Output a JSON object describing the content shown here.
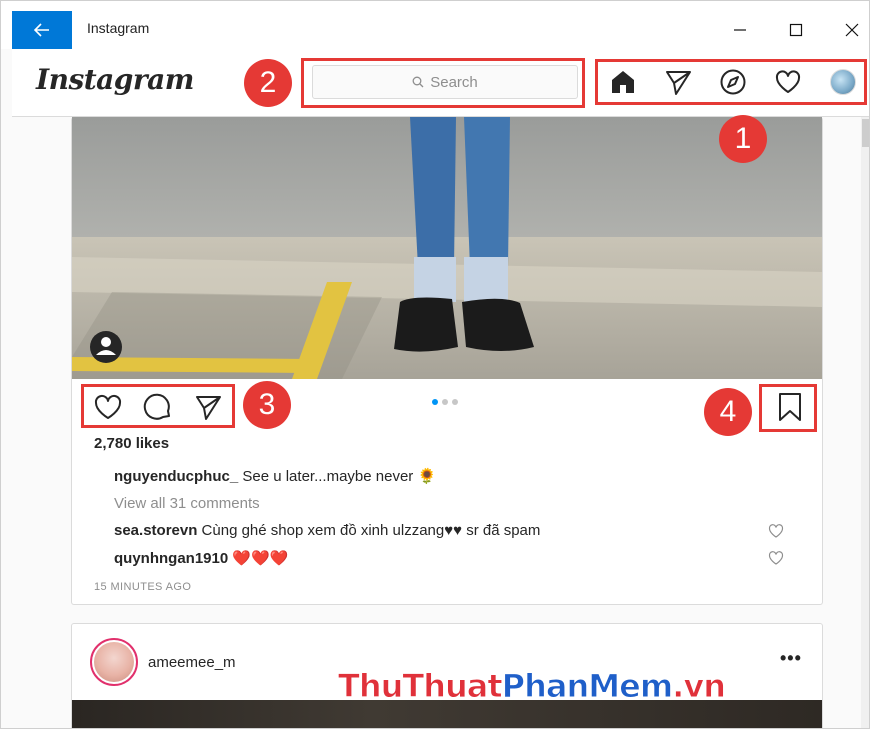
{
  "window": {
    "title": "Instagram",
    "accent": "#0078d7",
    "controls": {
      "minimize": "minimize-icon",
      "maximize": "maximize-icon",
      "close": "close-icon"
    }
  },
  "header": {
    "logo": "Instagram",
    "search_placeholder": "Search",
    "nav_icons": [
      "home-icon",
      "direct-message-icon",
      "explore-icon",
      "activity-heart-icon",
      "profile-avatar"
    ]
  },
  "annotations": {
    "badge_1": "1",
    "badge_2": "2",
    "badge_3": "3",
    "badge_4": "4",
    "color": "#e53935"
  },
  "post1": {
    "carousel_dots": 3,
    "carousel_active": 1,
    "likes": "2,780 likes",
    "caption_user": "nguyenducphuc_",
    "caption_text": " See u later...maybe never 🌻",
    "view_all": "View all 31 comments",
    "comments": [
      {
        "user": "sea.storevn",
        "text": " Cùng ghé shop xem đồ xinh ulzzang♥♥ sr đã spam"
      },
      {
        "user": "quynhngan1910",
        "text": " ❤️❤️❤️"
      }
    ],
    "time": "15 MINUTES AGO"
  },
  "post2": {
    "username": "ameemee_m",
    "more": "•••"
  },
  "watermark": {
    "part_a": "ThuThuat",
    "part_b": "PhanMem",
    "part_c": ".vn"
  }
}
